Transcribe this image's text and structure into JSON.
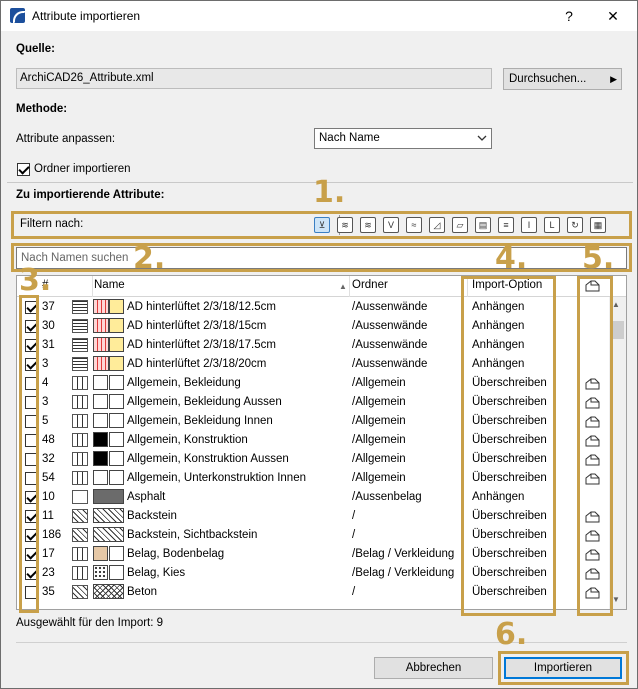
{
  "window": {
    "title": "Attribute importieren",
    "help_label": "?",
    "close_label": "✕"
  },
  "source": {
    "heading": "Quelle:",
    "file": "ArchiCAD26_Attribute.xml",
    "browse_label": "Durchsuchen...",
    "browse_caret": "▶"
  },
  "method": {
    "heading": "Methode:",
    "match_label": "Attribute anpassen:",
    "match_value": "Nach Name",
    "import_folders_label": "Ordner importieren",
    "import_folders_checked": true
  },
  "attributes": {
    "heading": "Zu importierende Attribute:",
    "filter_label": "Filtern nach:",
    "filter_icons": [
      "ebenen-filter-icon",
      "stifte-icon",
      "linientypen-icon",
      "schraffuren-icon",
      "oberflaechen-icon",
      "baustoffe-icon",
      "mehrschicht-icon",
      "profile-icon",
      "zonen-icon",
      "markup-icon",
      "bauteil-icon",
      "rotation-icon",
      "raster-icon"
    ],
    "search_placeholder": "Nach Namen suchen",
    "columns": {
      "num": "#",
      "name": "Name",
      "folder": "Ordner",
      "option": "Import-Option",
      "sort_arrow": "▲"
    },
    "rows": [
      {
        "checked": true,
        "num": "37",
        "type": "wall",
        "swatch": "red",
        "name": "AD hinterlüftet 2/3/18/12.5cm",
        "folder": "/Aussenwände",
        "option": "Anhängen",
        "house": false
      },
      {
        "checked": true,
        "num": "30",
        "type": "wall",
        "swatch": "red",
        "name": "AD hinterlüftet 2/3/18/15cm",
        "folder": "/Aussenwände",
        "option": "Anhängen",
        "house": false
      },
      {
        "checked": true,
        "num": "31",
        "type": "wall",
        "swatch": "red",
        "name": "AD hinterlüftet 2/3/18/17.5cm",
        "folder": "/Aussenwände",
        "option": "Anhängen",
        "house": false
      },
      {
        "checked": true,
        "num": "3",
        "type": "wall",
        "swatch": "red",
        "name": "AD hinterlüftet 2/3/18/20cm",
        "folder": "/Aussenwände",
        "option": "Anhängen",
        "house": false
      },
      {
        "checked": false,
        "num": "4",
        "type": "material",
        "swatch": "white",
        "name": "Allgemein, Bekleidung",
        "folder": "/Allgemein",
        "option": "Überschreiben",
        "house": true
      },
      {
        "checked": false,
        "num": "3",
        "type": "material",
        "swatch": "white",
        "name": "Allgemein, Bekleidung Aussen",
        "folder": "/Allgemein",
        "option": "Überschreiben",
        "house": true
      },
      {
        "checked": false,
        "num": "5",
        "type": "material",
        "swatch": "white",
        "name": "Allgemein, Bekleidung Innen",
        "folder": "/Allgemein",
        "option": "Überschreiben",
        "house": true
      },
      {
        "checked": false,
        "num": "48",
        "type": "material",
        "swatch": "black",
        "name": "Allgemein, Konstruktion",
        "folder": "/Allgemein",
        "option": "Überschreiben",
        "house": true
      },
      {
        "checked": false,
        "num": "32",
        "type": "material",
        "swatch": "black",
        "name": "Allgemein, Konstruktion Aussen",
        "folder": "/Allgemein",
        "option": "Überschreiben",
        "house": true
      },
      {
        "checked": false,
        "num": "54",
        "type": "material",
        "swatch": "white",
        "name": "Allgemein, Unterkonstruktion Innen",
        "folder": "/Allgemein",
        "option": "Überschreiben",
        "house": true
      },
      {
        "checked": true,
        "num": "10",
        "type": "surface",
        "swatch": "dark",
        "name": "Asphalt",
        "folder": "/Aussenbelag",
        "option": "Anhängen",
        "house": false
      },
      {
        "checked": true,
        "num": "11",
        "type": "fill",
        "swatch": "hatch",
        "name": "Backstein",
        "folder": "/",
        "option": "Überschreiben",
        "house": true
      },
      {
        "checked": true,
        "num": "186",
        "type": "fill",
        "swatch": "hatch",
        "name": "Backstein, Sichtbackstein",
        "folder": "/",
        "option": "Überschreiben",
        "house": true
      },
      {
        "checked": true,
        "num": "17",
        "type": "material",
        "swatch": "tan",
        "name": "Belag, Bodenbelag",
        "folder": "/Belag / Verkleidung",
        "option": "Überschreiben",
        "house": true
      },
      {
        "checked": true,
        "num": "23",
        "type": "material",
        "swatch": "dots",
        "name": "Belag, Kies",
        "folder": "/Belag / Verkleidung",
        "option": "Überschreiben",
        "house": true
      },
      {
        "checked": false,
        "num": "35",
        "type": "fill",
        "swatch": "cross",
        "name": "Beton",
        "folder": "/",
        "option": "Überschreiben",
        "house": true
      }
    ]
  },
  "footer": {
    "selected_count": "Ausgewählt für den Import: 9",
    "cancel_label": "Abbrechen",
    "import_label": "Importieren"
  },
  "annotations": [
    "1.",
    "2.",
    "3.",
    "4.",
    "5.",
    "6."
  ],
  "colors": {
    "annotation": "#c8a04a",
    "accent": "#0078d7"
  }
}
